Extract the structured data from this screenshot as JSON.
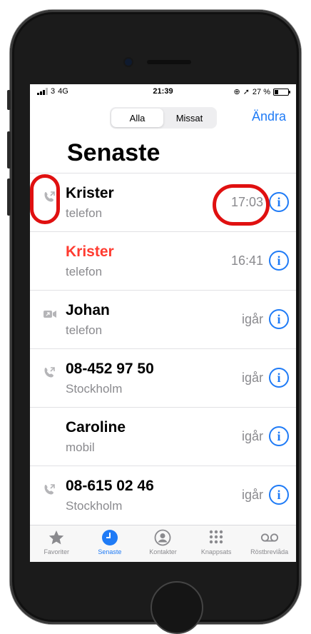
{
  "status_bar": {
    "carrier": "3",
    "network": "4G",
    "time": "21:39",
    "battery": "27 %"
  },
  "segments": [
    {
      "label": "Alla",
      "active": true
    },
    {
      "label": "Missat",
      "active": false
    }
  ],
  "edit_label": "Ändra",
  "title": "Senaste",
  "calls": [
    {
      "name": "Krister",
      "sub": "telefon",
      "time": "17:03",
      "missed": false,
      "icon": "outgoing-call-icon"
    },
    {
      "name": "Krister",
      "sub": "telefon",
      "time": "16:41",
      "missed": true,
      "icon": ""
    },
    {
      "name": "Johan",
      "sub": "telefon",
      "time": "igår",
      "missed": false,
      "icon": "facetime-video-icon"
    },
    {
      "name": "08-452 97 50",
      "sub": "Stockholm",
      "time": "igår",
      "missed": false,
      "icon": "outgoing-call-icon"
    },
    {
      "name": "Caroline",
      "sub": "mobil",
      "time": "igår",
      "missed": false,
      "icon": ""
    },
    {
      "name": "08-615 02 46",
      "sub": "Stockholm",
      "time": "igår",
      "missed": false,
      "icon": "outgoing-call-icon"
    }
  ],
  "tabs": [
    {
      "label": "Favoriter",
      "icon": "star-icon",
      "active": false
    },
    {
      "label": "Senaste",
      "icon": "clock-icon",
      "active": true
    },
    {
      "label": "Kontakter",
      "icon": "contact-icon",
      "active": false
    },
    {
      "label": "Knappsats",
      "icon": "keypad-icon",
      "active": false
    },
    {
      "label": "Röstbrevlåda",
      "icon": "voicemail-icon",
      "active": false
    }
  ],
  "colors": {
    "accent": "#1f7bf6",
    "missed": "#ff3b30",
    "annotation": "#e01010"
  }
}
